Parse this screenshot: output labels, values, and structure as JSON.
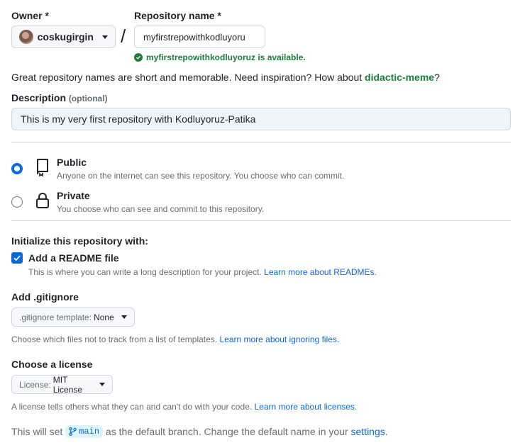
{
  "owner": {
    "label": "Owner *",
    "value": "coskugirgin"
  },
  "separator": "/",
  "repo_name": {
    "label": "Repository name *",
    "value": "myfirstrepowithkodluyoru",
    "availability": "myfirstrepowithkodluyoruz is available."
  },
  "inspiration": {
    "text": "Great repository names are short and memorable. Need inspiration? How about ",
    "suggestion": "didactic-meme",
    "suffix": "?"
  },
  "description": {
    "label": "Description",
    "optional": "(optional)",
    "value": "This is my very first repository with Kodluyoruz-Patika"
  },
  "visibility": {
    "public": {
      "title": "Public",
      "desc": "Anyone on the internet can see this repository. You choose who can commit.",
      "selected": true
    },
    "private": {
      "title": "Private",
      "desc": "You choose who can see and commit to this repository.",
      "selected": false
    }
  },
  "initialize": {
    "heading": "Initialize this repository with:",
    "readme_label": "Add a README file",
    "readme_checked": true,
    "readme_desc": "This is where you can write a long description for your project. ",
    "readme_link": "Learn more about READMEs."
  },
  "gitignore": {
    "heading": "Add .gitignore",
    "button_prefix": ".gitignore template:",
    "button_value": "None",
    "desc": "Choose which files not to track from a list of templates. ",
    "link": "Learn more about ignoring files."
  },
  "license": {
    "heading": "Choose a license",
    "button_prefix": "License:",
    "button_value": "MIT License",
    "desc": "A license tells others what they can and can't do with your code. ",
    "link": "Learn more about licenses."
  },
  "branch": {
    "prefix": "This will set ",
    "branch_name": "main",
    "middle": " as the default branch. Change the default name in your ",
    "link": "settings",
    "suffix": "."
  },
  "colors": {
    "accent": "#0969da",
    "success": "#1a7f37",
    "input_focus_bg": "#eef4fb",
    "muted": "#656d76"
  }
}
